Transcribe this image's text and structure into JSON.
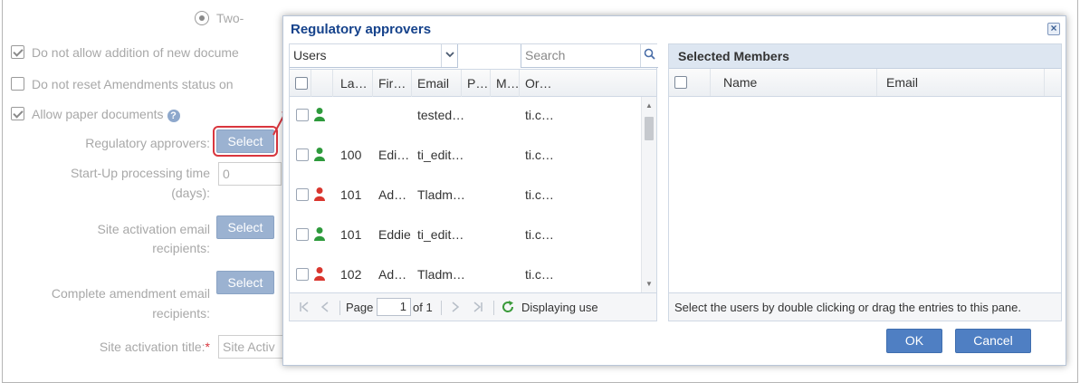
{
  "background_form": {
    "radio_label": "Two-",
    "checkbox_1": "Do not allow addition of new docume",
    "checkbox_2": "Do not reset Amendments status on",
    "checkbox_3": "Allow paper documents",
    "help_glyph": "?",
    "regulatory_label": "Regulatory approvers:",
    "regulatory_button": "Select",
    "startup_label_1": "Start-Up processing time",
    "startup_label_2": "(days):",
    "startup_value": "0",
    "site_activation_label_1": "Site activation email",
    "site_activation_label_2": "recipients:",
    "site_activation_button": "Select",
    "complete_label_1": "Complete amendment email",
    "complete_label_2": "recipients:",
    "complete_button": "Select",
    "title_label": "Site activation title:",
    "title_required": "*",
    "title_value": "Site Activ"
  },
  "dialog": {
    "title": "Regulatory approvers",
    "close_glyph": "×",
    "users_select": "Users",
    "search_placeholder": "Search",
    "columns": [
      "La…",
      "Fir…",
      "Email",
      "P…",
      "M…",
      "Or…"
    ],
    "rows": [
      {
        "last": "",
        "first": "",
        "email": "tested…",
        "org": "ti.c…",
        "status": "green"
      },
      {
        "last": "100",
        "first": "Edi…",
        "email": "ti_edit…",
        "org": "ti.c…",
        "status": "green"
      },
      {
        "last": "101",
        "first": "Ad…",
        "email": "Tladm…",
        "org": "ti.c…",
        "status": "red"
      },
      {
        "last": "101",
        "first": "Eddie",
        "email": "ti_edit…",
        "org": "ti.c…",
        "status": "green"
      },
      {
        "last": "102",
        "first": "Ad…",
        "email": "Tladm…",
        "org": "ti.c…",
        "status": "red"
      }
    ],
    "pager": {
      "page_label": "Page",
      "page_value": "1",
      "of_label": "of 1",
      "display_text": "Displaying use"
    },
    "selected": {
      "title": "Selected Members",
      "columns": [
        "Name",
        "Email"
      ],
      "hint": "Select the users by double clicking or drag the entries to this pane."
    },
    "ok_label": "OK",
    "cancel_label": "Cancel"
  },
  "colors": {
    "accent": "#4f7fc3",
    "title_blue": "#15428b",
    "highlight_red": "#d9363e",
    "active_green": "#2e9a3c",
    "inactive_red": "#d9362e"
  }
}
